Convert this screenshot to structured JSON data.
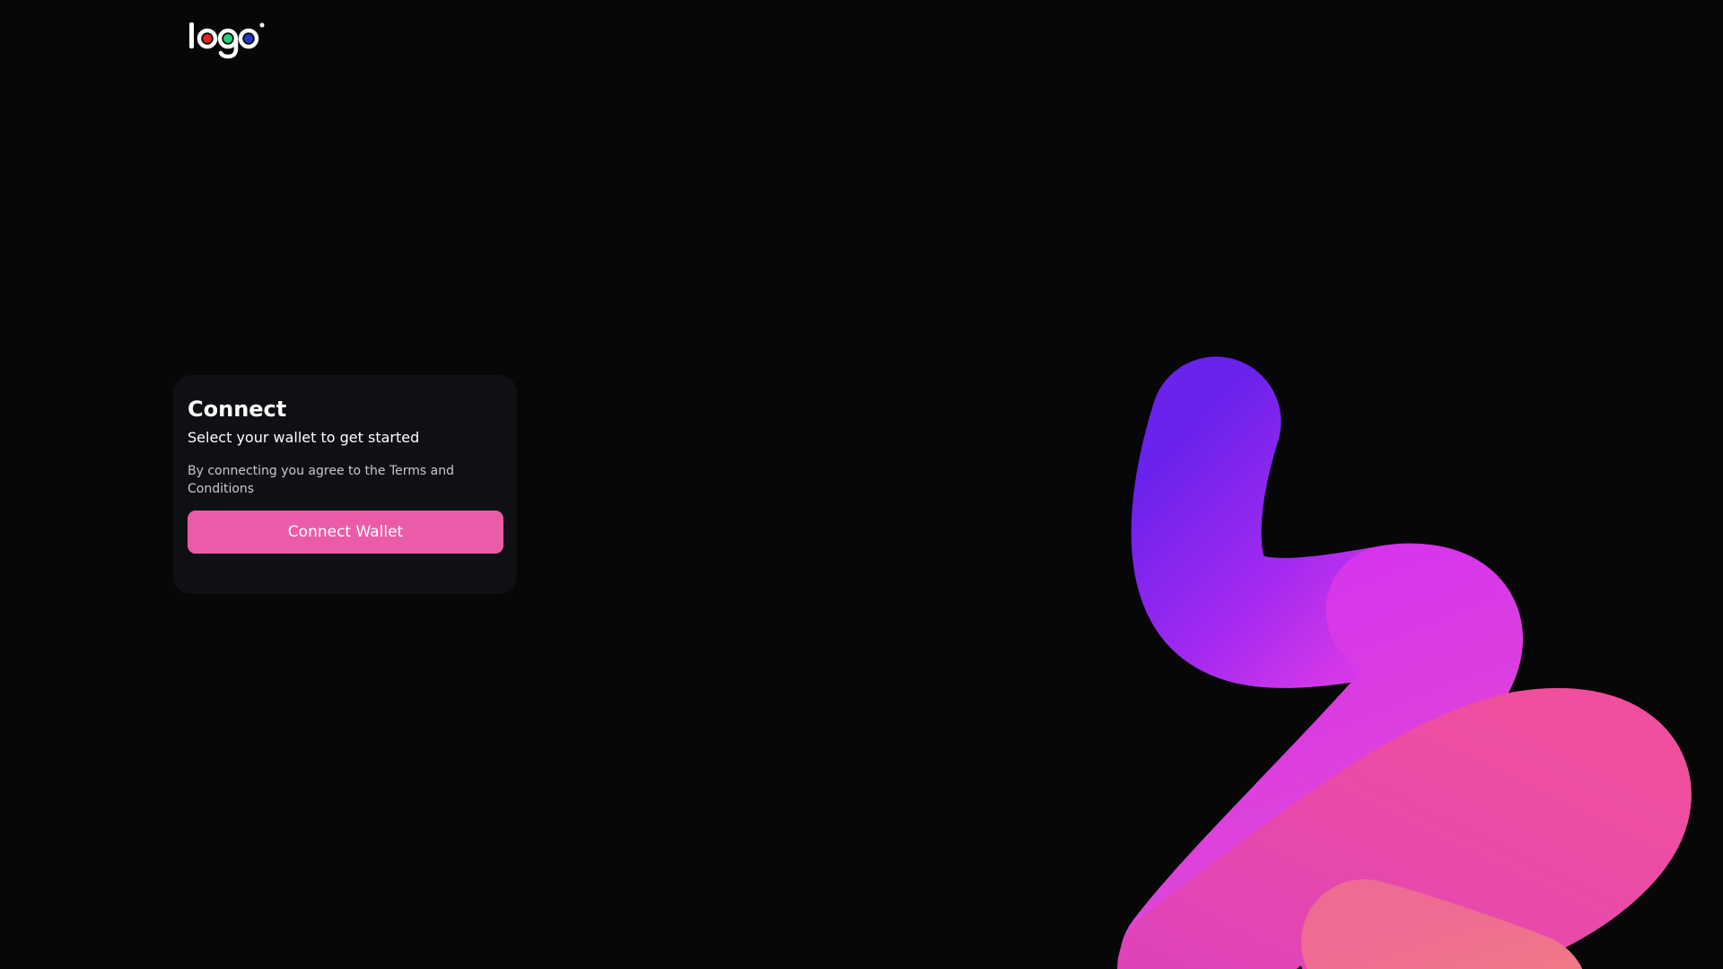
{
  "brand": {
    "logo_text": "logo",
    "logo_dot_colors": [
      "#e0261f",
      "#1fd07a",
      "#2339c9"
    ]
  },
  "connect_card": {
    "title": "Connect",
    "subtitle": "Select your wallet to get started",
    "terms_text": "By connecting you agree to the Terms and Conditions",
    "button_label": "Connect Wallet"
  },
  "colors": {
    "background": "#070708",
    "card_background": "#0f1013",
    "accent": "#ea5ca8",
    "ribbon_gradient": [
      "#6622ee",
      "#d634e8",
      "#ee4ea0",
      "#f07488"
    ]
  }
}
